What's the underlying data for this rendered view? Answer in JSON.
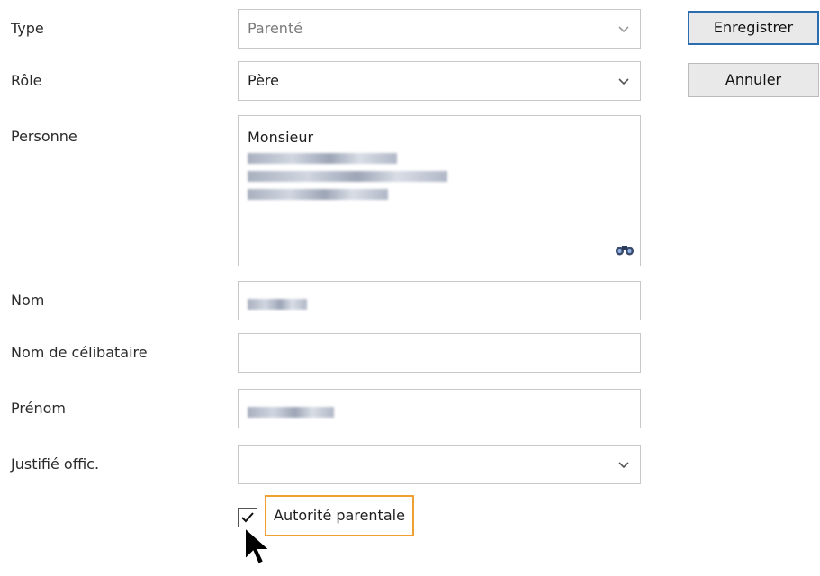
{
  "form": {
    "type": {
      "label": "Type",
      "value": "Parenté"
    },
    "role": {
      "label": "Rôle",
      "value": "Père"
    },
    "personne": {
      "label": "Personne",
      "line1": "Monsieur"
    },
    "nom": {
      "label": "Nom"
    },
    "nom_celibataire": {
      "label": "Nom de célibataire",
      "value": ""
    },
    "prenom": {
      "label": "Prénom"
    },
    "justifie": {
      "label": "Justifié offic.",
      "value": ""
    },
    "autorite": {
      "label": "Autorité parentale",
      "checked": true
    }
  },
  "buttons": {
    "save": "Enregistrer",
    "cancel": "Annuler"
  },
  "icons": {
    "dropdown": "chevron-down-icon",
    "search": "binoculars-icon",
    "check": "checkmark-icon",
    "cursor": "mouse-pointer-icon"
  },
  "colors": {
    "primary_border": "#2c6db2",
    "focus_highlight": "#f0a030",
    "field_border": "#c8c8c8"
  }
}
